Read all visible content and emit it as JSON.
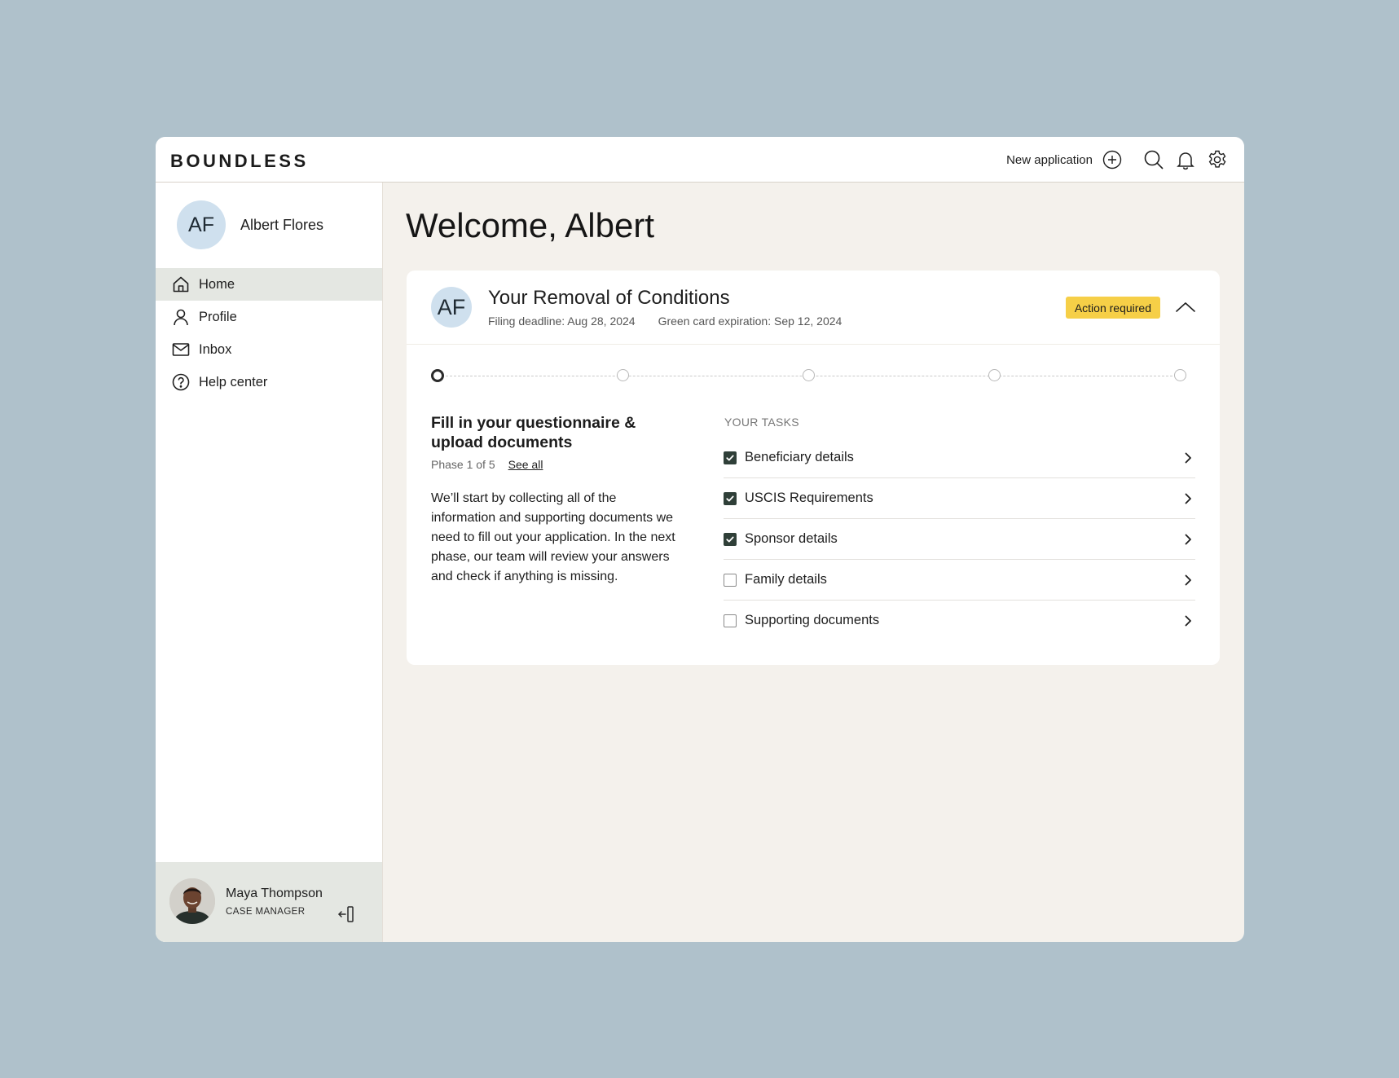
{
  "header": {
    "logo": "BOUNDLESS",
    "new_application_label": "New application"
  },
  "sidebar": {
    "user": {
      "initials": "AF",
      "name": "Albert Flores"
    },
    "items": [
      {
        "label": "Home",
        "icon": "home-icon",
        "active": true
      },
      {
        "label": "Profile",
        "icon": "user-icon"
      },
      {
        "label": "Inbox",
        "icon": "mail-icon"
      },
      {
        "label": "Help center",
        "icon": "help-circle-icon"
      }
    ],
    "case_manager": {
      "name": "Maya Thompson",
      "role": "CASE MANAGER"
    }
  },
  "main": {
    "welcome": "Welcome, Albert",
    "case": {
      "initials": "AF",
      "title": "Your Removal of Conditions",
      "filing_deadline": "Filing deadline: Aug 28, 2024",
      "green_card_expiration": "Green card expiration: Sep 12, 2024",
      "status_badge": "Action required",
      "phases_total": 5,
      "current_phase": 1,
      "phase_title": "Fill in your questionnaire & upload documents",
      "phase_progress": "Phase 1 of 5",
      "see_all": "See all",
      "phase_description": "We’ll start by collecting all of the information and supporting documents we need to fill out your application. In the next phase, our team will review your answers and check if anything is missing.",
      "tasks_label": "YOUR TASKS",
      "tasks": [
        {
          "label": "Beneficiary details",
          "done": true
        },
        {
          "label": "USCIS Requirements",
          "done": true
        },
        {
          "label": "Sponsor details",
          "done": true
        },
        {
          "label": "Family details",
          "done": false
        },
        {
          "label": "Supporting documents",
          "done": false
        }
      ]
    }
  },
  "colors": {
    "page_background": "#afc1cb",
    "accent_badge": "#f6cf47",
    "checkbox_checked": "#2f3f38",
    "avatar_bg": "#cfe0ee",
    "active_nav_bg": "#e4e7e2"
  }
}
